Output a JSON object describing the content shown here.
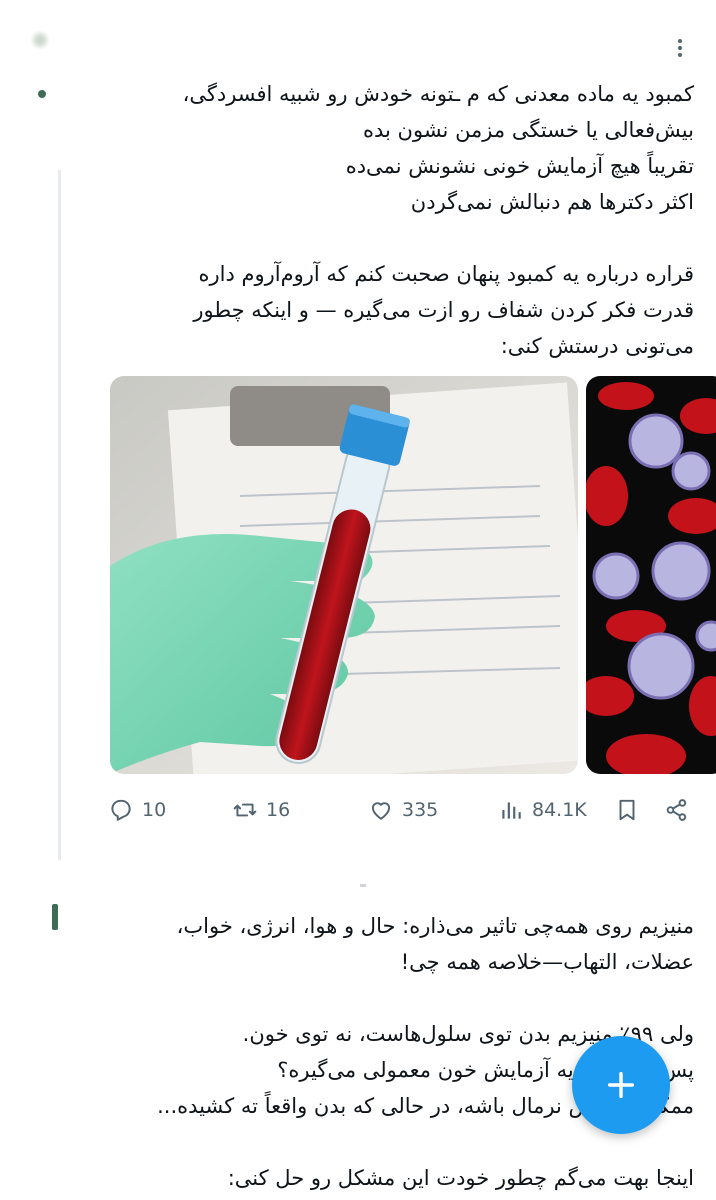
{
  "tweet1": {
    "text": "کمبود یه ماده معدنی که م ـتونه خودش رو شبیه افسردگی،\nبیش‌فعالی یا خستگی مزمن نشون بده\nتقریباً هیچ آزمایش خونی نشونش نمی‌ده\nاکثر دکترها هم دنبالش نمی‌گردن\n\nقراره درباره یه کمبود پنهان صحبت کنم که آروم‌آروم داره\nقدرت فکر کردن شفاف رو ازت می‌گیره — و اینکه چطور\nمی‌تونی درستش کنی:",
    "media": [
      {
        "icon": "blood-test-tube-photo"
      },
      {
        "icon": "blood-cells-photo"
      }
    ],
    "actions": {
      "replies": "10",
      "reposts": "16",
      "likes": "335",
      "views": "84.1K"
    }
  },
  "tweet2": {
    "text": "منیزیم روی همه‌چی تاثیر می‌ذاره: حال و هوا، انرژی، خواب،\nعضلات، التهاب—خلاصه همه چی!\n\nولی ۹۹٪ منیزیم بدن توی سلول‌هاست، نه توی خون.\nپس چرا دکتر یه آزمایش خون معمولی می‌گیره؟\nممکنه آزمایش نرمال باشه، در حالی که بدن واقعاً ته کشیده...\n\nاینجا بهت می‌گم چطور خودت این مشکل رو حل کنی:"
  },
  "fab": {
    "icon": "plus-icon"
  },
  "colors": {
    "accent": "#1d9bf0",
    "muted": "#536471",
    "text": "#0f1419"
  }
}
